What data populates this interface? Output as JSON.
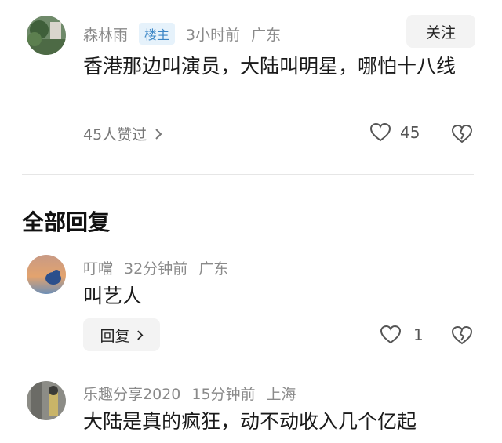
{
  "post": {
    "username": "森林雨",
    "badge": "楼主",
    "time": "3小时前",
    "location": "广东",
    "follow_label": "关注",
    "text": "香港那边叫演员，大陆叫明星，哪怕十八线",
    "liked_summary": "45人赞过",
    "like_count": "45"
  },
  "replies_section": {
    "title": "全部回复"
  },
  "replies": [
    {
      "username": "叮噹",
      "time": "32分钟前",
      "location": "广东",
      "text": "叫艺人",
      "reply_label": "回复",
      "like_count": "1"
    },
    {
      "username": "乐趣分享2020",
      "time": "15分钟前",
      "location": "上海",
      "text": "大陆是真的疯狂，动不动收入几个亿起"
    }
  ],
  "icons": {
    "like": "heart-outline-icon",
    "dislike": "broken-heart-icon",
    "chevron": "chevron-right-icon"
  }
}
